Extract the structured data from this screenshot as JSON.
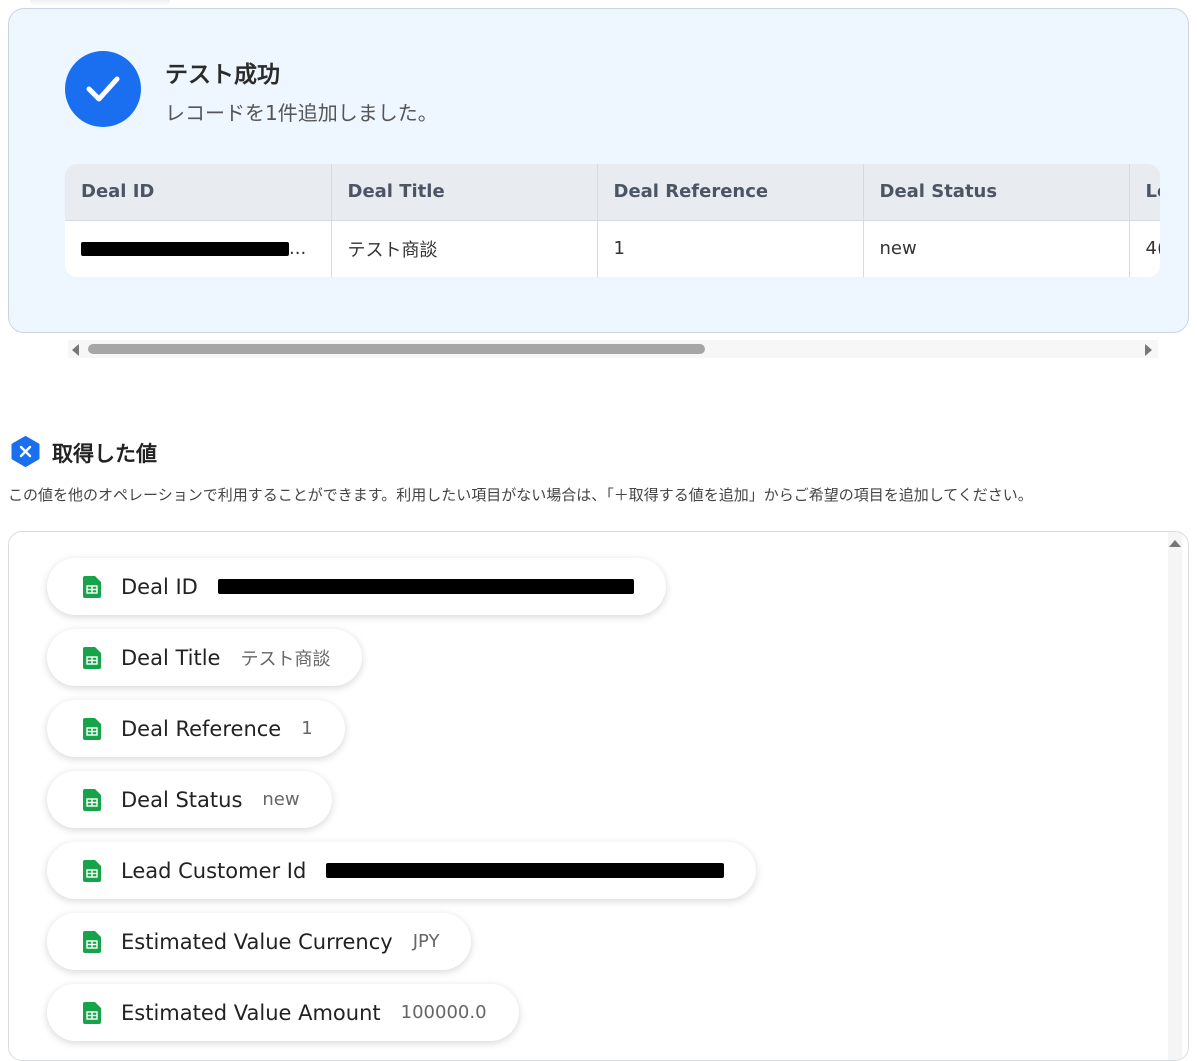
{
  "success": {
    "title": "テスト成功",
    "message": "レコードを1件追加しました。"
  },
  "table": {
    "headers": [
      "Deal ID",
      "Deal Title",
      "Deal Reference",
      "Deal Status",
      "Le"
    ],
    "row": [
      "",
      "テスト商談",
      "1",
      "new",
      "4("
    ],
    "row0_suffix": "..."
  },
  "section": {
    "title": "取得した値",
    "description": "この値を他のオペレーションで利用することができます。利用したい項目がない場合は、「＋取得する値を追加」からご希望の項目を追加してください。"
  },
  "values": [
    {
      "key": "Deal ID",
      "value": ""
    },
    {
      "key": "Deal Title",
      "value": "テスト商談"
    },
    {
      "key": "Deal Reference",
      "value": "1"
    },
    {
      "key": "Deal Status",
      "value": "new"
    },
    {
      "key": "Lead Customer Id",
      "value": ""
    },
    {
      "key": "Estimated Value Currency",
      "value": "JPY"
    },
    {
      "key": "Estimated Value Amount",
      "value": "100000.0"
    }
  ],
  "colors": {
    "accent": "#1a6ff0",
    "panel_bg": "#eef6ff",
    "sheet_green": "#17a34a"
  },
  "icons": {
    "success": "check-icon",
    "section": "variable-x-icon",
    "value": "spreadsheet-icon"
  }
}
